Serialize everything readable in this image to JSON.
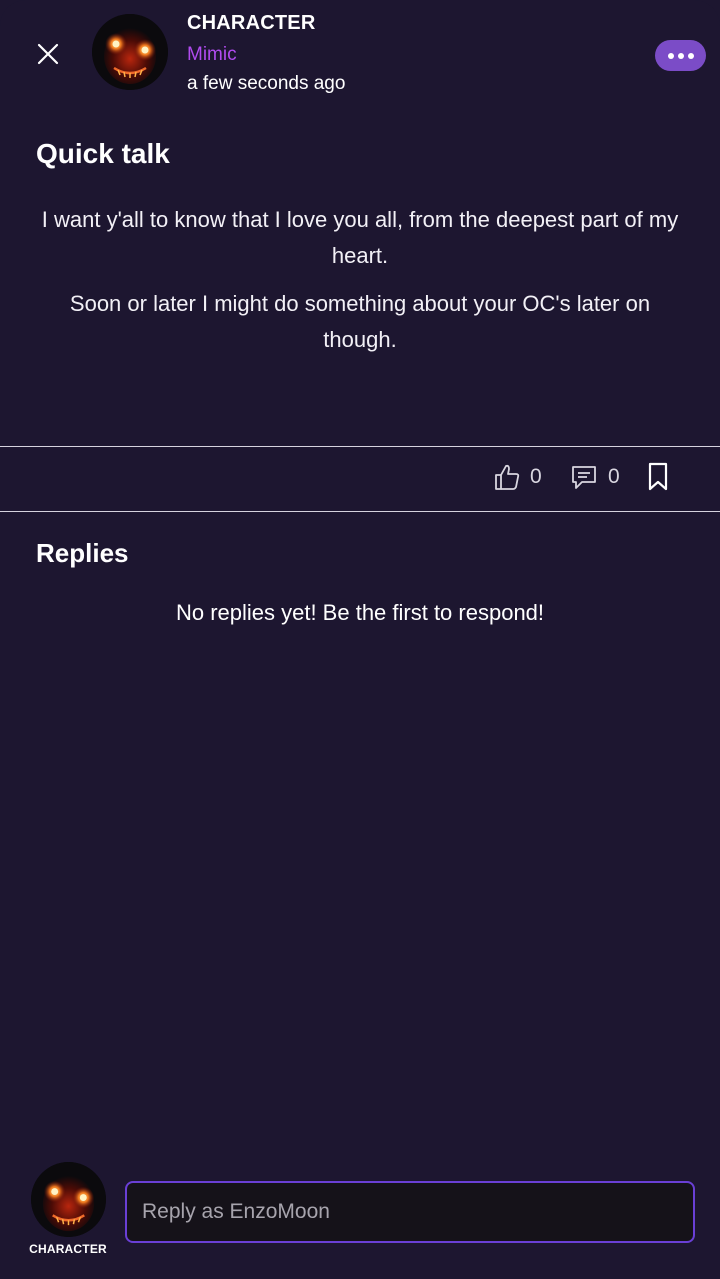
{
  "post": {
    "author_name": "CHARACTER",
    "author_tag": "Mimic",
    "time": "a few seconds ago",
    "title": "Quick talk",
    "paragraphs": [
      "I want y'all to know that I love you all, from the deepest part of my heart.",
      "Soon or later I might do something about your OC's later on though."
    ],
    "likes": "0",
    "comments": "0"
  },
  "icons": {
    "close": "close-icon",
    "more": "more-icon",
    "like": "thumbs-up-icon",
    "comment": "comment-icon",
    "bookmark": "bookmark-icon"
  },
  "replies": {
    "heading": "Replies",
    "empty_text": "No replies yet! Be the first to respond!"
  },
  "reply_bar": {
    "role_label": "CHARACTER",
    "placeholder": "Reply as EnzoMoon"
  },
  "colors": {
    "background": "#1d1630",
    "accent": "#7b4cc7",
    "author_tag": "#b04bef"
  }
}
